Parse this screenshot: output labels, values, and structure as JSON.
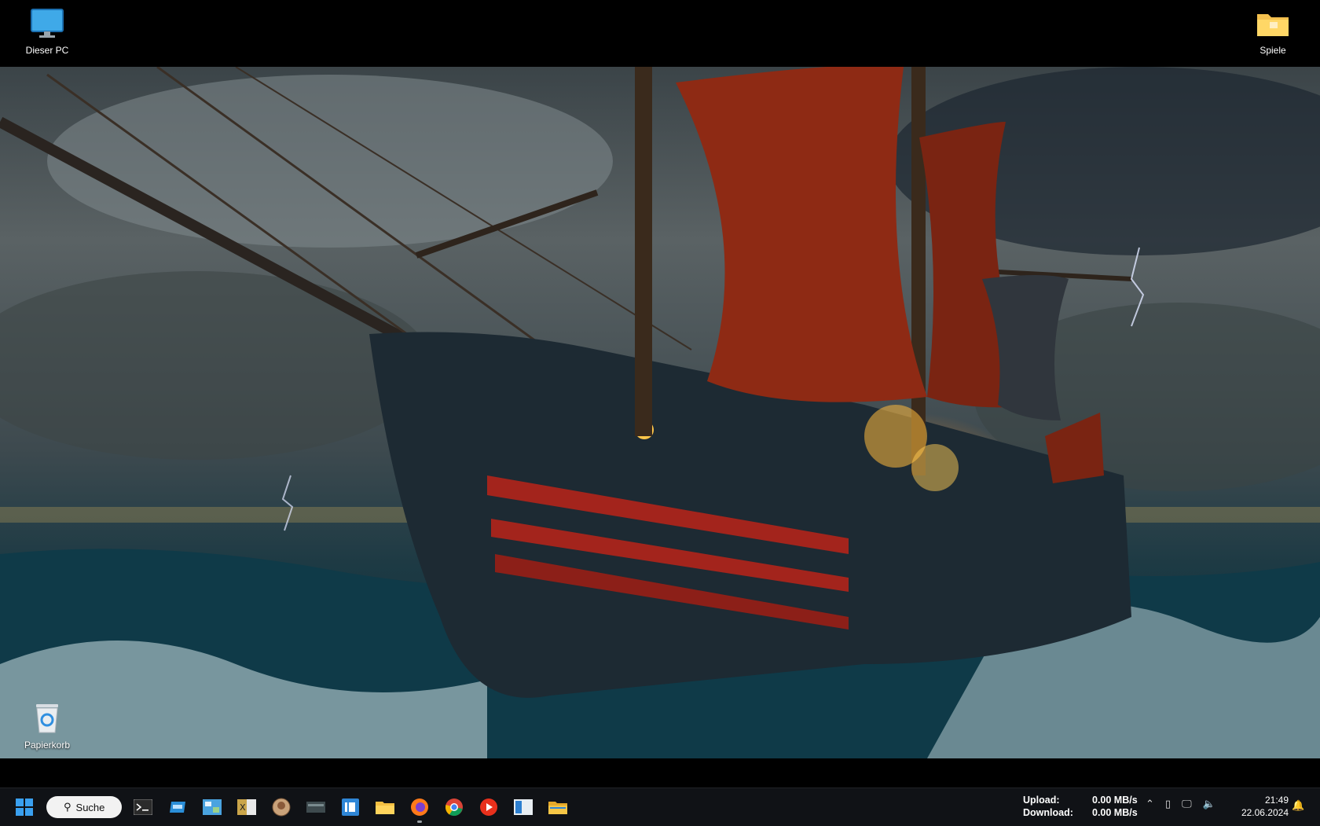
{
  "desktop": {
    "icons": {
      "this_pc": "Dieser PC",
      "games": "Spiele",
      "recycle_bin": "Papierkorb"
    }
  },
  "taskbar": {
    "search_label": "Suche",
    "pinned_apps": [
      "terminal-icon",
      "drive-app-icon",
      "control-panel-icon",
      "spreadsheet-icon",
      "avatar-app-icon",
      "monitor-app-icon",
      "id-app-icon",
      "file-explorer-icon",
      "firefox-icon",
      "chrome-icon",
      "media-player-icon",
      "window-app-icon",
      "folder-icon"
    ],
    "network_monitor": {
      "upload_label": "Upload:",
      "upload_value": "0.00 MB/s",
      "download_label": "Download:",
      "download_value": "0.00 MB/s"
    },
    "clock": {
      "time": "21:49",
      "date": "22.06.2024"
    }
  },
  "colors": {
    "taskbar_bg": "#101216",
    "accent": "#0a84ff"
  }
}
